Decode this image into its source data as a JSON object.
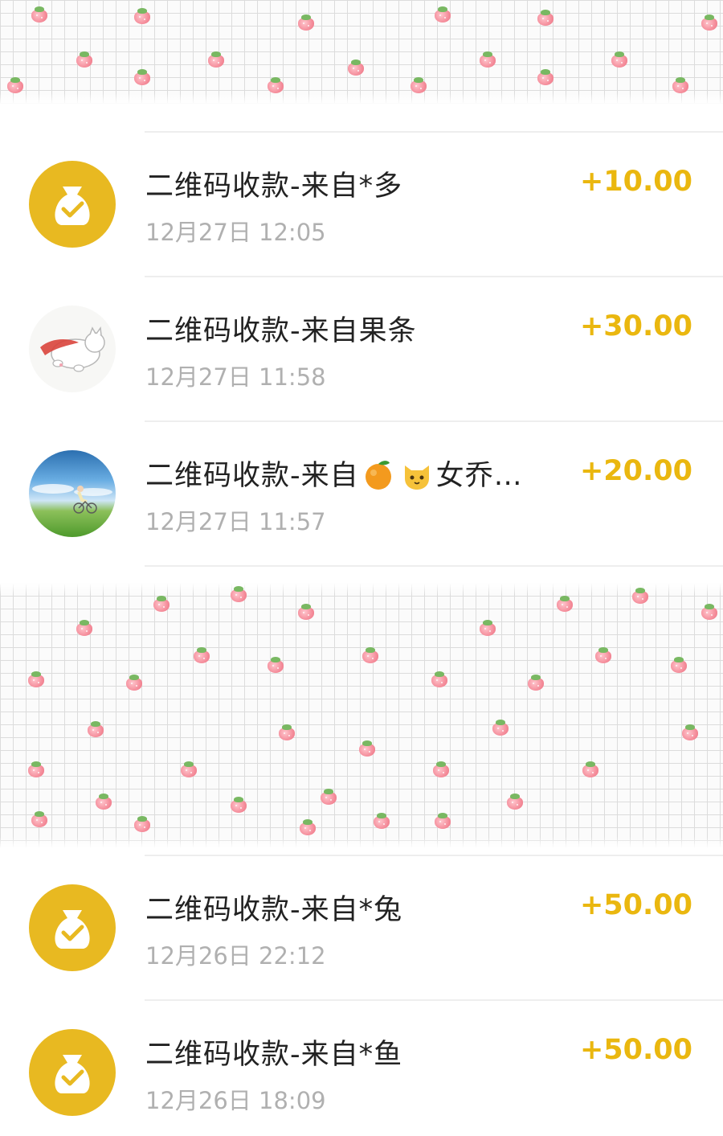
{
  "transactions": [
    {
      "title": "二维码收款-来自*多",
      "time": "12月27日 12:05",
      "amount": "+10.00",
      "avatar": "money-bag-icon"
    },
    {
      "title": "二维码收款-来自果条",
      "time": "12月27日 11:58",
      "amount": "+30.00",
      "avatar": "flying-cat-avatar"
    },
    {
      "title_prefix": "二维码收款-来自",
      "title_suffix": "女乔…",
      "emojis": [
        "orange-emoji",
        "cat-face-emoji"
      ],
      "time": "12月27日 11:57",
      "amount": "+20.00",
      "avatar": "cyclist-scene-avatar"
    },
    {
      "title": "二维码收款-来自*兔",
      "time": "12月26日 22:12",
      "amount": "+50.00",
      "avatar": "money-bag-icon"
    },
    {
      "title": "二维码收款-来自*鱼",
      "time": "12月26日 18:09",
      "amount": "+50.00",
      "avatar": "money-bag-icon"
    }
  ],
  "colors": {
    "amount": "#eab70f",
    "bag_avatar": "#e8b921",
    "title": "#222222",
    "time": "#b0b0b0",
    "sticker_berry": "#f48a98"
  }
}
